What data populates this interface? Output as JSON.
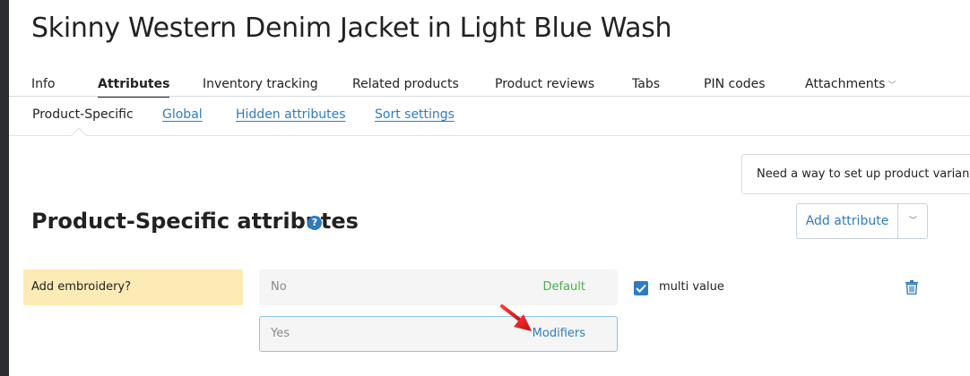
{
  "page": {
    "title": "Skinny Western Denim Jacket in Light Blue Wash"
  },
  "tabs": [
    {
      "label": "Info"
    },
    {
      "label": "Attributes"
    },
    {
      "label": "Inventory tracking"
    },
    {
      "label": "Related products"
    },
    {
      "label": "Product reviews"
    },
    {
      "label": "Tabs"
    },
    {
      "label": "PIN codes"
    },
    {
      "label": "Attachments"
    }
  ],
  "subtabs": [
    {
      "label": "Product-Specific"
    },
    {
      "label": "Global"
    },
    {
      "label": "Hidden attributes"
    },
    {
      "label": "Sort settings"
    }
  ],
  "variants_hint": "Need a way to set up product variants?",
  "section": {
    "title": "Product-Specific attributes",
    "help_icon": "?",
    "add_button": "Add attribute"
  },
  "attribute": {
    "name": "Add embroidery?",
    "values": [
      {
        "value": "No",
        "tag": "Default"
      },
      {
        "value": "Yes",
        "tag": "Modifiers"
      }
    ],
    "multi_value_label": "multi value",
    "multi_value_checked": true
  },
  "colors": {
    "accent": "#2e7cc0",
    "default_tag": "#4caf50",
    "attribute_highlight": "#fcebb5",
    "annotation_arrow": "#e8141b"
  }
}
